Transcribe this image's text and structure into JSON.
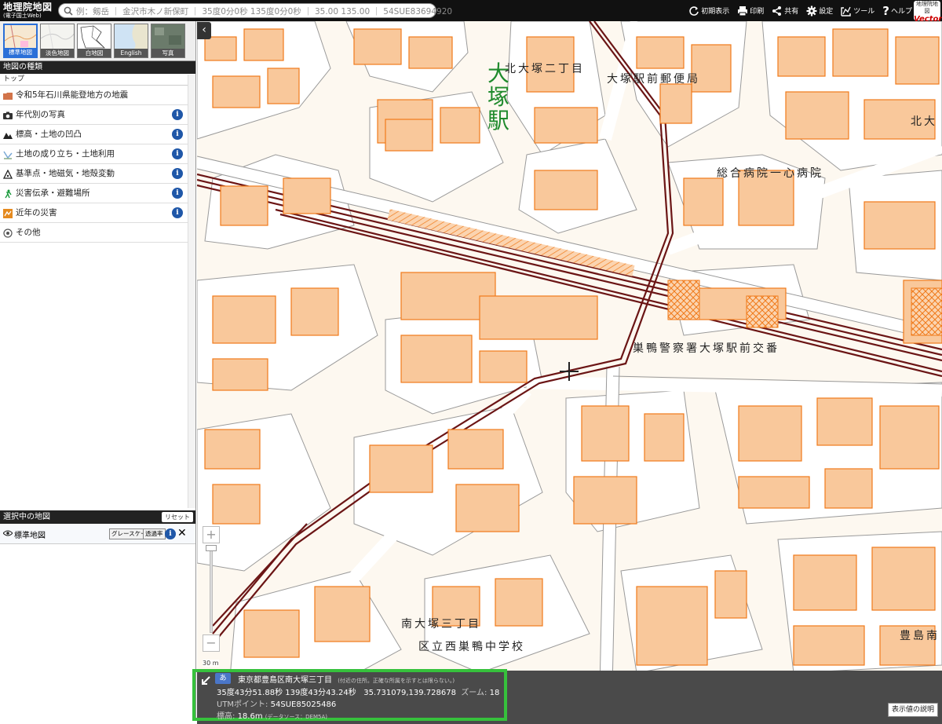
{
  "header": {
    "logo_line1": "地理院地図",
    "logo_line2": "(電子国土Web)",
    "search_placeholder": "例：剱岳 ｜ 金沢市木ノ新保町 ｜ 35度0分0秒 135度0分0秒 ｜ 35.00 135.00 ｜ 54SUE83694920",
    "tools": [
      {
        "icon": "reset-view-icon",
        "label": "初期表示"
      },
      {
        "icon": "printer-icon",
        "label": "印刷"
      },
      {
        "icon": "share-icon",
        "label": "共有"
      },
      {
        "icon": "gear-icon",
        "label": "設定"
      },
      {
        "icon": "ruler-icon",
        "label": "ツール"
      },
      {
        "icon": "help-icon",
        "label": "ヘルプ"
      }
    ],
    "vector_logo_top": "地理院地図",
    "vector_logo_bottom": "Vector"
  },
  "thumbs": [
    {
      "label": "標準地図",
      "active": true
    },
    {
      "label": "淡色地図",
      "active": false
    },
    {
      "label": "白地図",
      "active": false
    },
    {
      "label": "English",
      "active": false
    },
    {
      "label": "写真",
      "active": false
    }
  ],
  "sidebar": {
    "section_title": "地図の種類",
    "breadcrumb": "トップ",
    "categories": [
      {
        "icon": "folder-icon",
        "label": "令和5年石川県能登地方の地震",
        "info": false
      },
      {
        "icon": "camera-icon",
        "label": "年代別の写真",
        "info": true
      },
      {
        "icon": "mountain-icon",
        "label": "標高・土地の凹凸",
        "info": true
      },
      {
        "icon": "land-icon",
        "label": "土地の成り立ち・土地利用",
        "info": true
      },
      {
        "icon": "triangle-icon",
        "label": "基準点・地磁気・地殻変動",
        "info": true
      },
      {
        "icon": "evacuation-icon",
        "label": "災害伝承・避難場所",
        "info": true
      },
      {
        "icon": "disaster-icon",
        "label": "近年の災害",
        "info": true
      },
      {
        "icon": "other-icon",
        "label": "その他",
        "info": false
      }
    ],
    "info_glyph": "i",
    "selected_title": "選択中の地図",
    "reset_label": "リセット",
    "selected_map": {
      "name": "標準地図",
      "grayscale_label": "グレースケール",
      "opacity_label": "透過率",
      "close_glyph": "✕"
    },
    "collapse_glyph": "‹"
  },
  "map": {
    "station_name": "大塚駅",
    "labels": {
      "kita_otsuka": "北大塚二丁目",
      "post_office": "大塚駅前郵便局",
      "kita_edge": "北大",
      "hospital": "総合病院一心病院",
      "police": "巣鴨警察署大塚駅前交番",
      "minami_otsuka": "南大塚三丁目",
      "school": "区立西巣鴨中学校",
      "toshima": "豊島南"
    },
    "zoom_in": "+",
    "zoom_out": "−",
    "scale_text": "30 m"
  },
  "info_panel": {
    "kana": "あ",
    "address": "東京都豊島区南大塚三丁目",
    "address_note": "(付近の住所。正確な所属を示すとは限らない。)",
    "dms": "35度43分51.88秒 139度43分43.24秒",
    "decimal": "35.731079,139.728678",
    "zoom_label": "ズーム:",
    "zoom_value": "18",
    "utm_label": "UTMポイント:",
    "utm_value": "54SUE85025486",
    "elev_label": "標高:",
    "elev_value": "18.6m",
    "elev_source": "(データソース：DEM5A)",
    "legend_button": "表示値の説明"
  },
  "colors": {
    "building_fill": "#f9c89b",
    "building_stroke": "#f07a1a",
    "rail": "#6b1515",
    "station_text": "#1f8a2c",
    "info_border": "#36c13c",
    "info_bg": "#4a4a4a",
    "header_bg": "#111111"
  }
}
